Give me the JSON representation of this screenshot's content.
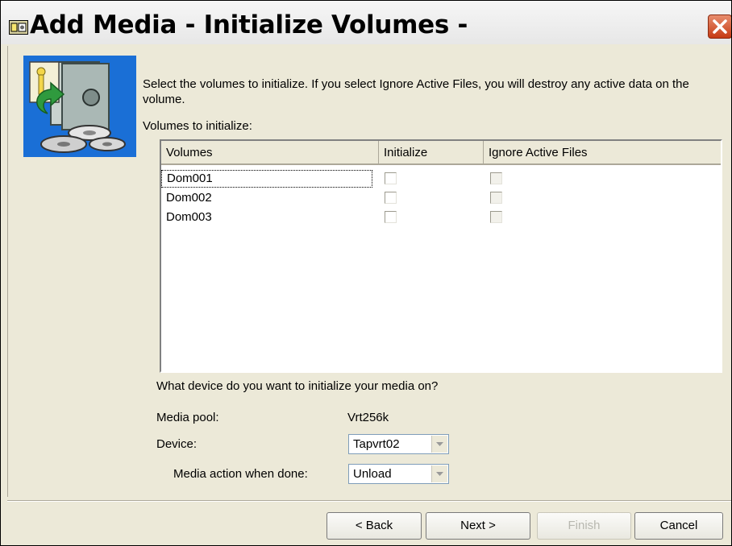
{
  "window": {
    "title": "Add Media - Initialize Volumes -"
  },
  "intro": {
    "description": "Select the volumes to initialize. If you select Ignore Active Files, you will destroy any active data on the volume.",
    "volumes_label": "Volumes to initialize:"
  },
  "table": {
    "columns": [
      "Volumes",
      "Initialize",
      "Ignore Active Files"
    ],
    "rows": [
      {
        "volume": "Dom001",
        "initialize": false,
        "ignore_active_files": false
      },
      {
        "volume": "Dom002",
        "initialize": false,
        "ignore_active_files": false
      },
      {
        "volume": "Dom003",
        "initialize": false,
        "ignore_active_files": false
      }
    ]
  },
  "device_section": {
    "question": "What device do you want to initialize your media on?",
    "media_pool_label": "Media pool:",
    "media_pool_value": "Vrt256k",
    "device_label": "Device:",
    "device_value": "Tapvrt02",
    "media_action_label": "Media action when done:",
    "media_action_value": "Unload"
  },
  "buttons": {
    "back": "< Back",
    "next": "Next >",
    "finish": "Finish",
    "cancel": "Cancel"
  },
  "icons": {
    "title": "media-library-icon",
    "close": "close-icon",
    "wizard": "media-safe-icon",
    "dropdown": "chevron-down-icon"
  },
  "colors": {
    "close_button": "#d2532e",
    "wizard_background": "#1a6fd6"
  }
}
